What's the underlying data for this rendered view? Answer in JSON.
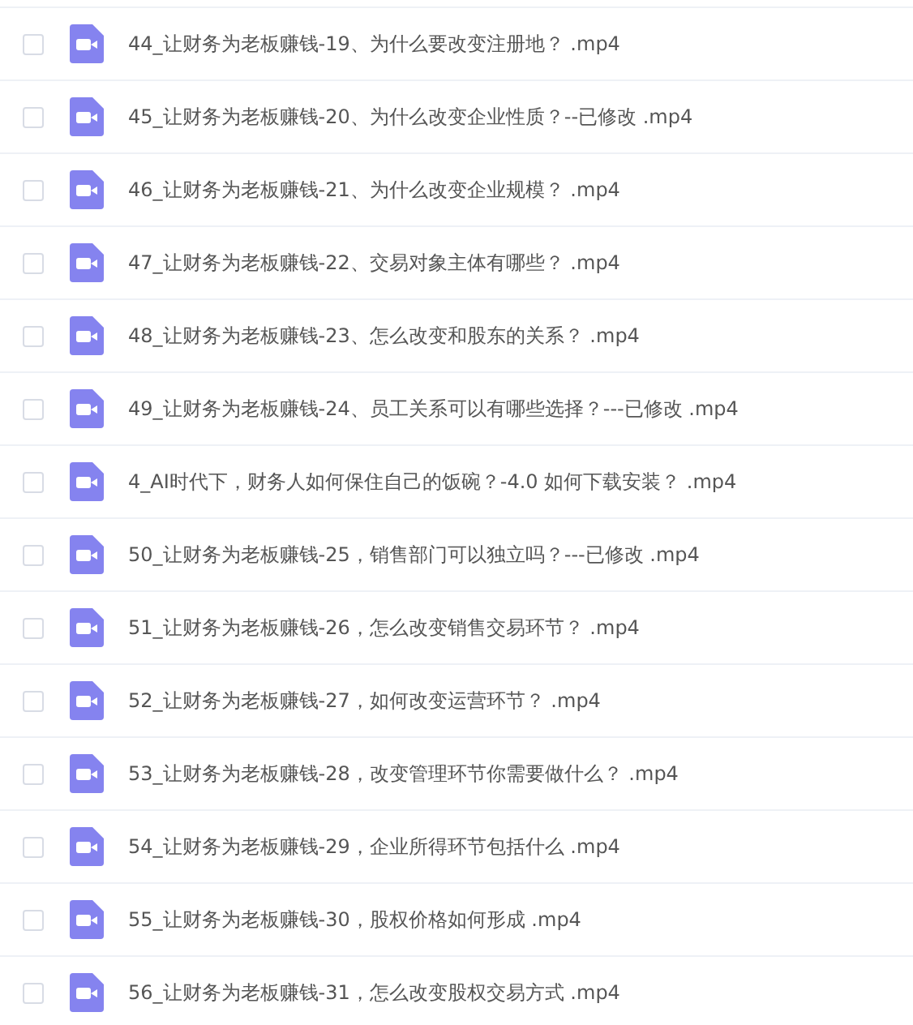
{
  "files": [
    {
      "name": "44_让财务为老板赚钱-19、为什么要改变注册地？ .mp4",
      "checked": false
    },
    {
      "name": "45_让财务为老板赚钱-20、为什么改变企业性质？--已修改 .mp4",
      "checked": false
    },
    {
      "name": "46_让财务为老板赚钱-21、为什么改变企业规模？ .mp4",
      "checked": false
    },
    {
      "name": "47_让财务为老板赚钱-22、交易对象主体有哪些？ .mp4",
      "checked": false
    },
    {
      "name": "48_让财务为老板赚钱-23、怎么改变和股东的关系？ .mp4",
      "checked": false
    },
    {
      "name": "49_让财务为老板赚钱-24、员工关系可以有哪些选择？---已修改 .mp4",
      "checked": false
    },
    {
      "name": "4_AI时代下，财务人如何保住自己的饭碗？-4.0 如何下载安装？ .mp4",
      "checked": false
    },
    {
      "name": "50_让财务为老板赚钱-25，销售部门可以独立吗？---已修改 .mp4",
      "checked": false
    },
    {
      "name": "51_让财务为老板赚钱-26，怎么改变销售交易环节？ .mp4",
      "checked": false
    },
    {
      "name": "52_让财务为老板赚钱-27，如何改变运营环节？ .mp4",
      "checked": false
    },
    {
      "name": "53_让财务为老板赚钱-28，改变管理环节你需要做什么？ .mp4",
      "checked": false
    },
    {
      "name": "54_让财务为老板赚钱-29，企业所得环节包括什么 .mp4",
      "checked": false
    },
    {
      "name": "55_让财务为老板赚钱-30，股权价格如何形成 .mp4",
      "checked": false
    },
    {
      "name": "56_让财务为老板赚钱-31，怎么改变股权交易方式 .mp4",
      "checked": false
    }
  ]
}
